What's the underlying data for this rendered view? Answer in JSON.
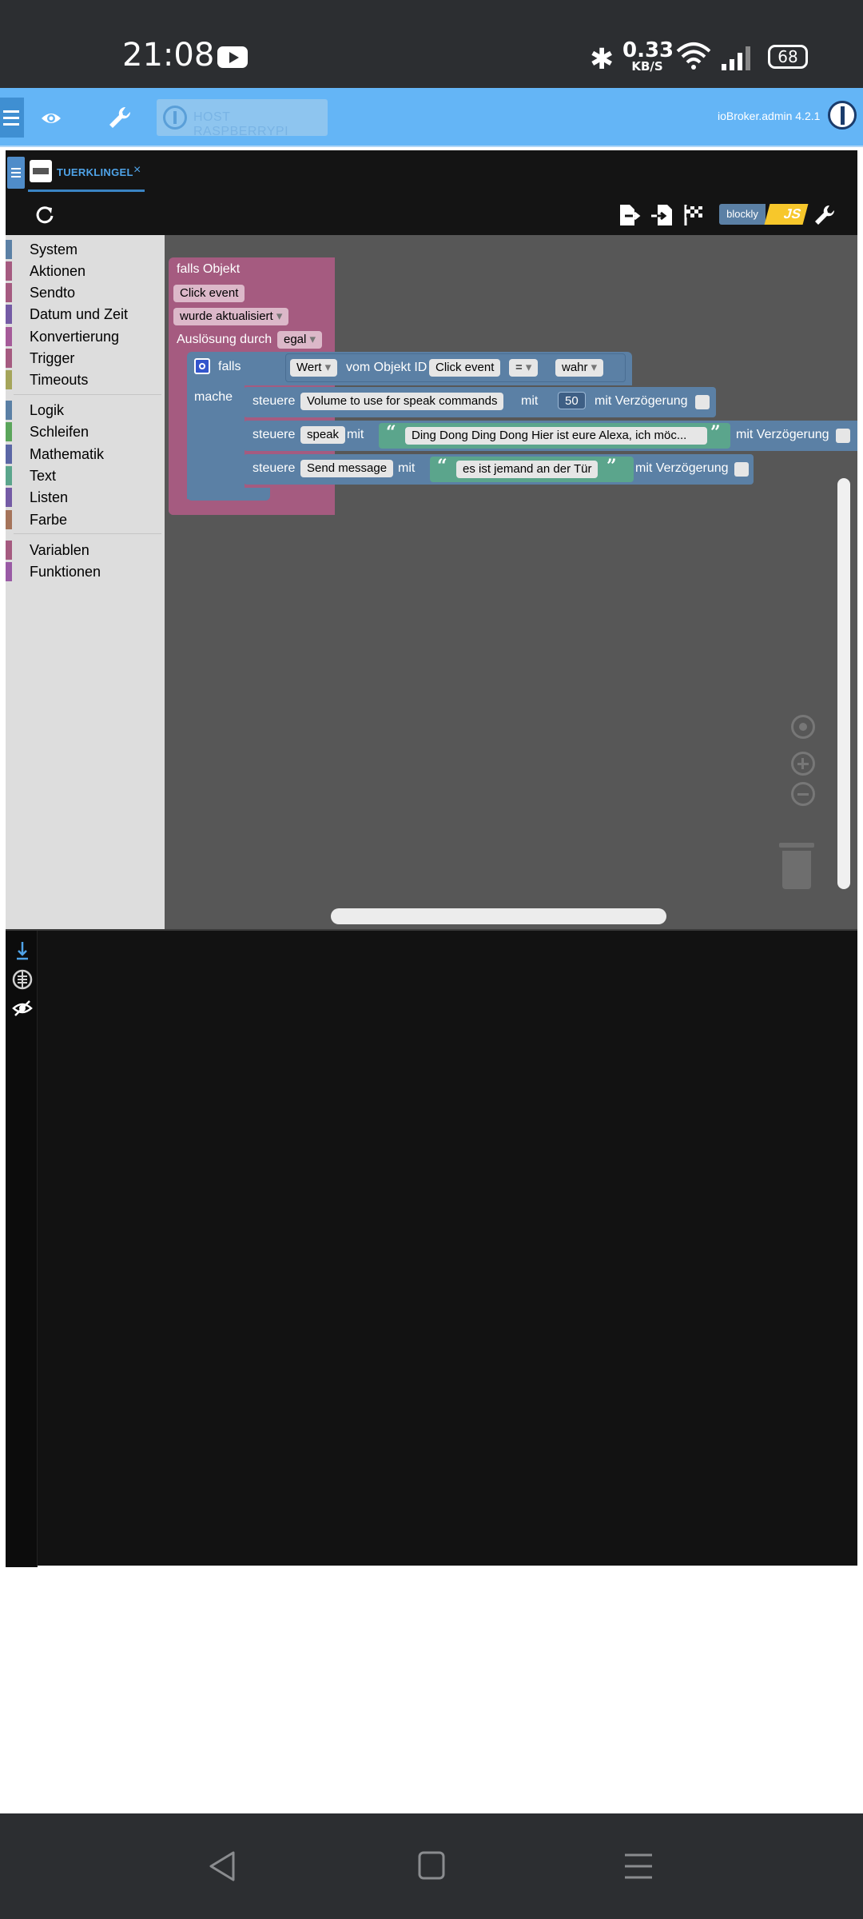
{
  "status_bar": {
    "time": "21:08",
    "speed_value": "0.33",
    "speed_unit": "KB/S",
    "battery": "68",
    "icons": [
      "youtube-icon",
      "bluetooth-icon",
      "wifi-icon",
      "signal-icon",
      "battery-icon"
    ]
  },
  "header": {
    "host_label": "HOST RASPBERRYPI",
    "version": "ioBroker.admin 4.2.1",
    "accent_color": "#64b5f6"
  },
  "editor": {
    "tab_label": "TUERKLINGEL",
    "tab_close": "×",
    "blockly_label": "blockly",
    "js_label": "JS"
  },
  "toolbox": {
    "groups": [
      [
        {
          "label": "System",
          "color": "#5b80a5"
        },
        {
          "label": "Aktionen",
          "color": "#a55b80"
        },
        {
          "label": "Sendto",
          "color": "#a55b80"
        },
        {
          "label": "Datum und Zeit",
          "color": "#745ba5"
        },
        {
          "label": "Konvertierung",
          "color": "#a55b99"
        },
        {
          "label": "Trigger",
          "color": "#a55b80"
        },
        {
          "label": "Timeouts",
          "color": "#a5a55b"
        }
      ],
      [
        {
          "label": "Logik",
          "color": "#5b80a5"
        },
        {
          "label": "Schleifen",
          "color": "#5ba55b"
        },
        {
          "label": "Mathematik",
          "color": "#5b67a5"
        },
        {
          "label": "Text",
          "color": "#5ba58c"
        },
        {
          "label": "Listen",
          "color": "#745ba5"
        },
        {
          "label": "Farbe",
          "color": "#a5745b"
        }
      ],
      [
        {
          "label": "Variablen",
          "color": "#a55b80"
        },
        {
          "label": "Funktionen",
          "color": "#995ba5"
        }
      ]
    ]
  },
  "blocks": {
    "trigger": {
      "title": "falls Objekt",
      "object": "Click event",
      "condition": "wurde aktualisiert",
      "trigger_by_label": "Auslösung durch",
      "trigger_by_value": "egal"
    },
    "if_block": {
      "if_label": "falls",
      "do_label": "mache",
      "value_field": "Wert",
      "of_object_label": "vom Objekt ID",
      "object": "Click event",
      "operator": "=",
      "compare": "wahr"
    },
    "actions": [
      {
        "control_label": "steuere",
        "target": "Volume to use for speak commands",
        "with_label": "mit",
        "value": "50",
        "delay_label": "mit Verzögerung"
      },
      {
        "control_label": "steuere",
        "target": "speak",
        "with_label": "mit",
        "value": "Ding Dong Ding Dong Hier ist eure Alexa, ich möc...",
        "delay_label": "mit Verzögerung"
      },
      {
        "control_label": "steuere",
        "target": "Send message",
        "with_label": "mit",
        "value": "es ist jemand an der Tür",
        "delay_label": "mit Verzögerung"
      }
    ]
  }
}
